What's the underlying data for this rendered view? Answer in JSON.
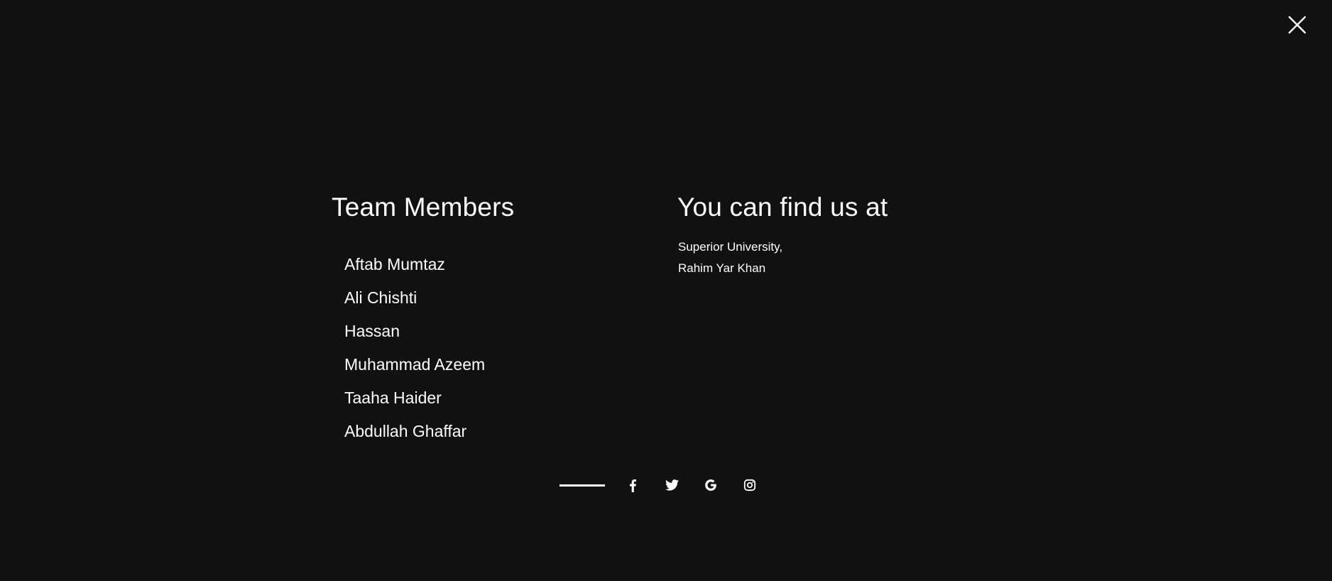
{
  "team": {
    "title": "Team Members",
    "members": [
      "Aftab Mumtaz",
      "Ali Chishti",
      "Hassan",
      "Muhammad Azeem",
      "Taaha Haider",
      "Abdullah Ghaffar"
    ]
  },
  "location": {
    "title": "You can find us at",
    "address_line1": "Superior University,",
    "address_line2": "Rahim Yar Khan"
  },
  "social": {
    "icons": [
      "facebook-icon",
      "twitter-icon",
      "google-icon",
      "instagram-icon"
    ]
  },
  "close": {
    "icon": "close-icon"
  },
  "colors": {
    "background": "#111111",
    "text": "#ffffff"
  }
}
